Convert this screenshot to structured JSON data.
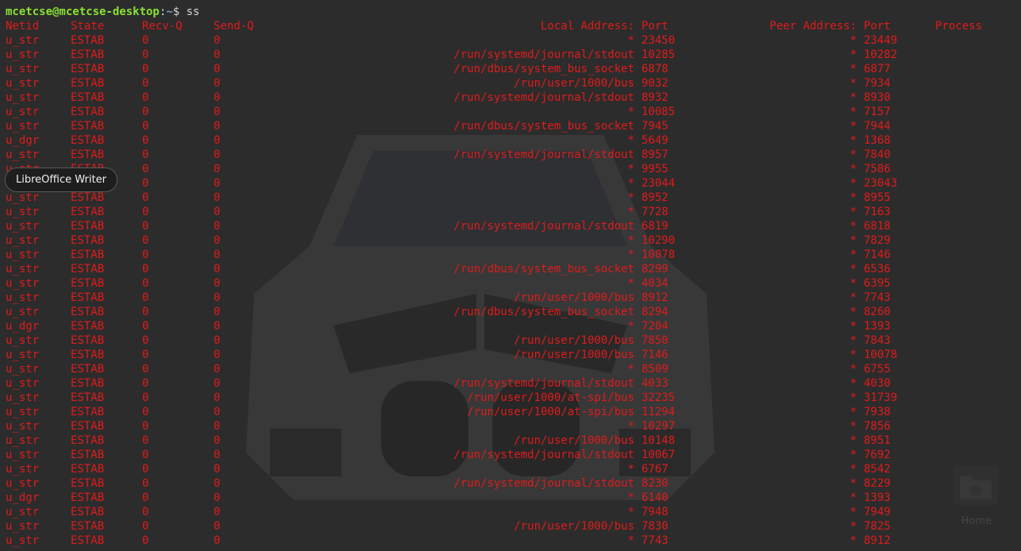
{
  "prompt": {
    "user_host": "mcetcse@mcetcse-desktop",
    "colon": ":",
    "path": "~",
    "dollar": "$",
    "command": " ss"
  },
  "headers": {
    "netid": "Netid",
    "state": "State",
    "recvq": "Recv-Q",
    "sendq": "Send-Q",
    "local_addr": "Local Address:",
    "local_port": "Port",
    "peer_addr": "Peer Address:",
    "peer_port": "Port",
    "process": "Process"
  },
  "rows": [
    [
      "u_str",
      "ESTAB",
      "0",
      "0",
      "*",
      "23450",
      "*",
      "23449"
    ],
    [
      "u_str",
      "ESTAB",
      "0",
      "0",
      "/run/systemd/journal/stdout",
      "10285",
      "*",
      "10282"
    ],
    [
      "u_str",
      "ESTAB",
      "0",
      "0",
      "/run/dbus/system_bus_socket",
      "6878",
      "*",
      "6877"
    ],
    [
      "u_str",
      "ESTAB",
      "0",
      "0",
      "/run/user/1000/bus",
      "9032",
      "*",
      "7934"
    ],
    [
      "u_str",
      "ESTAB",
      "0",
      "0",
      "/run/systemd/journal/stdout",
      "8932",
      "*",
      "8930"
    ],
    [
      "u_str",
      "ESTAB",
      "0",
      "0",
      "*",
      "10085",
      "*",
      "7157"
    ],
    [
      "u_str",
      "ESTAB",
      "0",
      "0",
      "/run/dbus/system_bus_socket",
      "7945",
      "*",
      "7944"
    ],
    [
      "u_dgr",
      "ESTAB",
      "0",
      "0",
      "*",
      "5649",
      "*",
      "1368"
    ],
    [
      "u_str",
      "ESTAB",
      "0",
      "0",
      "/run/systemd/journal/stdout",
      "8957",
      "*",
      "7840"
    ],
    [
      "u_str",
      "ESTAB",
      "0",
      "0",
      "*",
      "9955",
      "*",
      "7586"
    ],
    [
      "u_str",
      "ESTAB",
      "0",
      "0",
      "*",
      "23044",
      "*",
      "23043"
    ],
    [
      "u_str",
      "ESTAB",
      "0",
      "0",
      "*",
      "8952",
      "*",
      "8955"
    ],
    [
      "u_str",
      "ESTAB",
      "0",
      "0",
      "*",
      "7728",
      "*",
      "7163"
    ],
    [
      "u_str",
      "ESTAB",
      "0",
      "0",
      "/run/systemd/journal/stdout",
      "6819",
      "*",
      "6818"
    ],
    [
      "u_str",
      "ESTAB",
      "0",
      "0",
      "*",
      "10290",
      "*",
      "7829"
    ],
    [
      "u_str",
      "ESTAB",
      "0",
      "0",
      "*",
      "10078",
      "*",
      "7146"
    ],
    [
      "u_str",
      "ESTAB",
      "0",
      "0",
      "/run/dbus/system_bus_socket",
      "8299",
      "*",
      "6536"
    ],
    [
      "u_str",
      "ESTAB",
      "0",
      "0",
      "*",
      "4034",
      "*",
      "6395"
    ],
    [
      "u_str",
      "ESTAB",
      "0",
      "0",
      "/run/user/1000/bus",
      "8912",
      "*",
      "7743"
    ],
    [
      "u_str",
      "ESTAB",
      "0",
      "0",
      "/run/dbus/system_bus_socket",
      "8294",
      "*",
      "8260"
    ],
    [
      "u_dgr",
      "ESTAB",
      "0",
      "0",
      "*",
      "7204",
      "*",
      "1393"
    ],
    [
      "u_str",
      "ESTAB",
      "0",
      "0",
      "/run/user/1000/bus",
      "7850",
      "*",
      "7843"
    ],
    [
      "u_str",
      "ESTAB",
      "0",
      "0",
      "/run/user/1000/bus",
      "7146",
      "*",
      "10078"
    ],
    [
      "u_str",
      "ESTAB",
      "0",
      "0",
      "*",
      "8509",
      "*",
      "6755"
    ],
    [
      "u_str",
      "ESTAB",
      "0",
      "0",
      "/run/systemd/journal/stdout",
      "4033",
      "*",
      "4030"
    ],
    [
      "u_str",
      "ESTAB",
      "0",
      "0",
      "/run/user/1000/at-spi/bus",
      "32235",
      "*",
      "31739"
    ],
    [
      "u_str",
      "ESTAB",
      "0",
      "0",
      "/run/user/1000/at-spi/bus",
      "11294",
      "*",
      "7938"
    ],
    [
      "u_str",
      "ESTAB",
      "0",
      "0",
      "*",
      "10297",
      "*",
      "7856"
    ],
    [
      "u_str",
      "ESTAB",
      "0",
      "0",
      "/run/user/1000/bus",
      "10148",
      "*",
      "8951"
    ],
    [
      "u_str",
      "ESTAB",
      "0",
      "0",
      "/run/systemd/journal/stdout",
      "10067",
      "*",
      "7692"
    ],
    [
      "u_str",
      "ESTAB",
      "0",
      "0",
      "*",
      "6767",
      "*",
      "8542"
    ],
    [
      "u_str",
      "ESTAB",
      "0",
      "0",
      "/run/systemd/journal/stdout",
      "8230",
      "*",
      "8229"
    ],
    [
      "u_dgr",
      "ESTAB",
      "0",
      "0",
      "*",
      "6140",
      "*",
      "1393"
    ],
    [
      "u_str",
      "ESTAB",
      "0",
      "0",
      "*",
      "7948",
      "*",
      "7949"
    ],
    [
      "u_str",
      "ESTAB",
      "0",
      "0",
      "/run/user/1000/bus",
      "7830",
      "*",
      "7825"
    ],
    [
      "u_str",
      "ESTAB",
      "0",
      "0",
      "*",
      "7743",
      "*",
      "8912"
    ]
  ],
  "tooltip": "LibreOffice Writer",
  "desktop": {
    "home_label": "Home",
    "home_icon": "home-folder-icon"
  },
  "colors": {
    "output": "#e01b1b",
    "prompt_user": "#8ae234",
    "prompt_path": "#729fcf",
    "background": "#2c2c2c"
  }
}
